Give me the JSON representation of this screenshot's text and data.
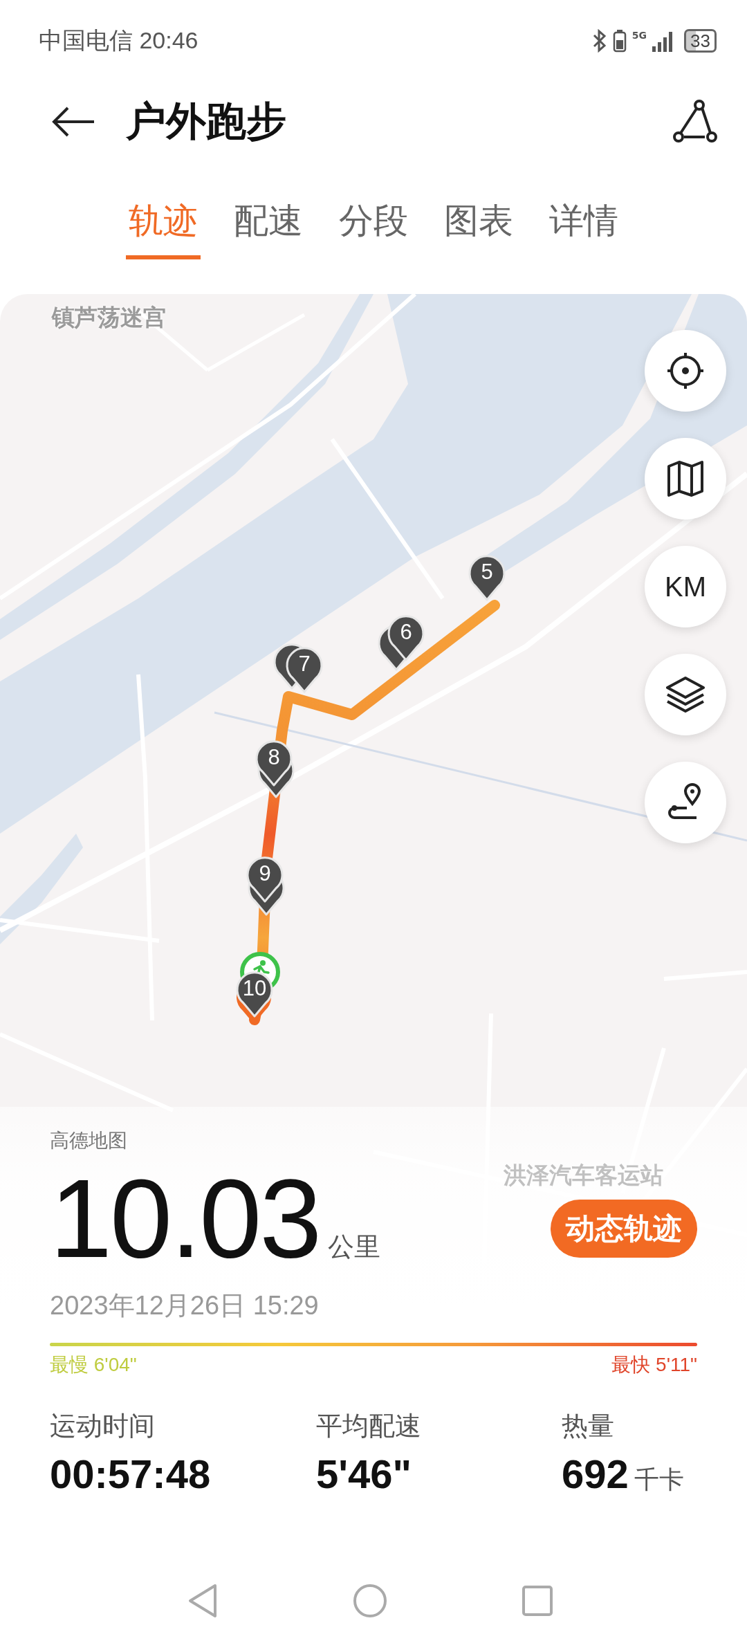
{
  "status_bar": {
    "carrier_time": "中国电信 20:46",
    "network": "5G",
    "battery": "33"
  },
  "header": {
    "title": "户外跑步"
  },
  "tabs": [
    {
      "label": "轨迹",
      "selected": true
    },
    {
      "label": "配速",
      "selected": false
    },
    {
      "label": "分段",
      "selected": false
    },
    {
      "label": "图表",
      "selected": false
    },
    {
      "label": "详情",
      "selected": false
    }
  ],
  "map": {
    "labels": [
      "镇芦荡迷宫",
      "洪泽汽车客运站"
    ],
    "controls": [
      {
        "kind": "locate"
      },
      {
        "kind": "map"
      },
      {
        "kind": "unit",
        "label": "KM"
      },
      {
        "kind": "layers"
      },
      {
        "kind": "route"
      }
    ],
    "markers": [
      "5",
      "6",
      "7",
      "8",
      "9",
      "10"
    ],
    "attribution": "高德地图"
  },
  "summary": {
    "distance": "10.03",
    "unit": "公里",
    "replay_button": "动态轨迹",
    "date": "2023年12月26日 15:29",
    "slowest": "最慢 6'04\"",
    "fastest": "最快 5'11\""
  },
  "stats": [
    {
      "label": "运动时间",
      "value": "00:57:48"
    },
    {
      "label": "平均配速",
      "value": "5'46\""
    },
    {
      "label": "热量",
      "value": "692",
      "unit": "千卡"
    }
  ]
}
